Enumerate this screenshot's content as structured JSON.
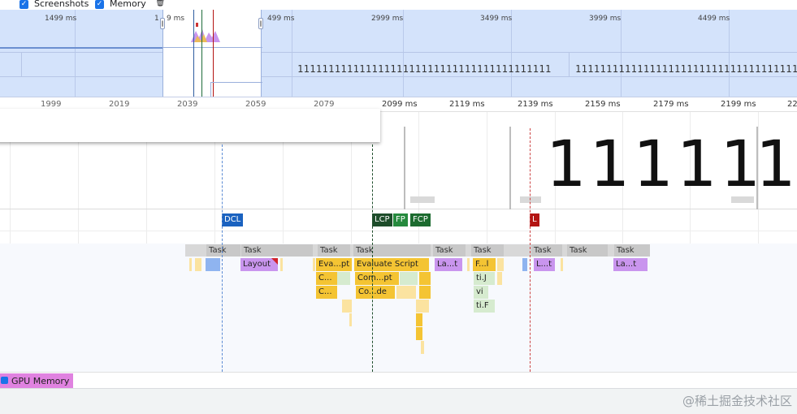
{
  "toolbar": {
    "screenshots_label": "Screenshots",
    "memory_label": "Memory",
    "check_glyph": "✓",
    "trash_glyph": "🗑"
  },
  "overview": {
    "ticks": [
      "1499 ms",
      "1",
      "9 ms",
      "499 ms",
      "2999 ms",
      "3499 ms",
      "3999 ms",
      "4499 ms"
    ],
    "ones_text": "11111111111111111111111111111111111111111",
    "ones_text_2": "11111111111111111111111111111111111111111"
  },
  "ruler": {
    "labels": [
      "1999",
      "2019",
      "2039",
      "2059",
      "2079",
      "2099 ms",
      "2119 ms",
      "2139 ms",
      "2159 ms",
      "2179 ms",
      "2199 ms",
      "22"
    ]
  },
  "screenshots": {
    "big_text_1": "11111",
    "big_text_2": "1"
  },
  "timings": {
    "dcl": "DCL",
    "lcp": "LCP",
    "fp": "FP",
    "fcp": "FCP",
    "l": "L",
    "colors": {
      "dcl": "#1a62c0",
      "lcp": "#1e4d2b",
      "fp": "#268a3e",
      "fcp": "#1c6b2f",
      "l": "#b31412"
    }
  },
  "main": {
    "tasks": [
      "Task",
      "Task",
      "Task",
      "Task",
      "Task",
      "Task",
      "Task",
      "Task",
      "Task"
    ],
    "row1": [
      "Layout",
      "Eva...pt",
      "Evaluate Script",
      "La...t",
      "F...l",
      "L...t",
      "La...t"
    ],
    "row2": [
      "C...",
      "Com...pt",
      "ti.J"
    ],
    "row3": [
      "C...",
      "Co...de",
      "vi"
    ],
    "row4": [
      "ti.F"
    ]
  },
  "gpu": {
    "label": "GPU Memory"
  },
  "watermark": "@稀土掘金技术社区"
}
